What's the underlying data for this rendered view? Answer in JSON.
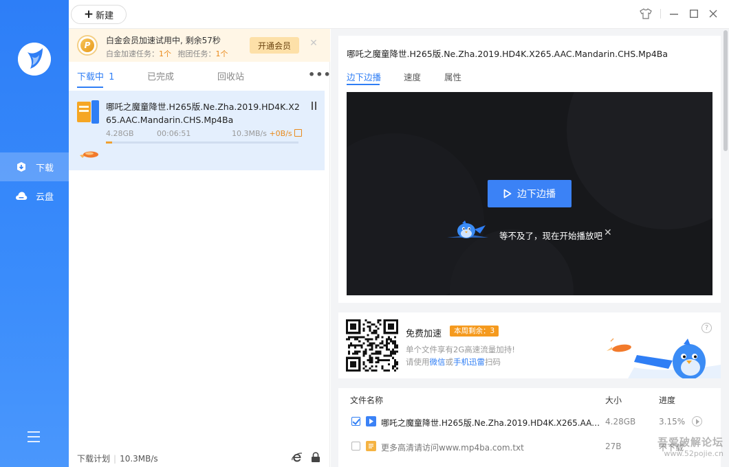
{
  "sidebar": {
    "items": [
      {
        "label": "下载",
        "icon": "download-icon",
        "active": true
      },
      {
        "label": "云盘",
        "icon": "cloud-icon",
        "active": false
      }
    ],
    "menu_icon": "menu-icon",
    "color": "#2f7ef5"
  },
  "toolbar": {
    "new_label": "新建",
    "icons": [
      "skin-icon",
      "settings-icon",
      "minimize-icon",
      "maximize-icon",
      "close-icon"
    ]
  },
  "banner": {
    "title": "白金会员加速试用中, 剩余57秒",
    "accel_label": "白金加速任务：",
    "accel_count": "1个",
    "rescue_label": "抱团任务：",
    "rescue_count": "1个",
    "button": "开通会员"
  },
  "tabs": [
    {
      "label": "下载中",
      "count": "1",
      "active": true
    },
    {
      "label": "已完成",
      "active": false
    },
    {
      "label": "回收站",
      "active": false
    }
  ],
  "task": {
    "name": "哪吒之魔童降世.H265版.Ne.Zha.2019.HD4K.X265.AAC.Mandarin.CHS.Mp4Ba",
    "size": "4.28GB",
    "time": "00:06:51",
    "speed": "10.3MB/s",
    "accel": "+0B/s",
    "progress": 0.0315
  },
  "footer": {
    "plan_label": "下载计划",
    "speed": "10.3MB/s"
  },
  "detail": {
    "title": "哪吒之魔童降世.H265版.Ne.Zha.2019.HD4K.X265.AAC.Mandarin.CHS.Mp4Ba",
    "tabs": [
      "边下边播",
      "速度",
      "属性"
    ],
    "play_button": "边下边播",
    "tip": "等不及了，现在开始播放吧"
  },
  "promo": {
    "title": "免费加速",
    "badge": "本周剩余：3",
    "line1": "单个文件享有2G高速流量加持!",
    "line2_prefix": "请使用",
    "line2_link1": "微信",
    "line2_mid": "或",
    "line2_link2": "手机迅雷",
    "line2_suffix": "扫码"
  },
  "files": {
    "headers": {
      "name": "文件名称",
      "size": "大小",
      "progress": "进度"
    },
    "rows": [
      {
        "checked": true,
        "icon": "video-file-icon",
        "name": "哪吒之魔童降世.H265版.Ne.Zha.2019.HD4K.X265.AAC.Mandarin.CHS.Mp4Ba",
        "size": "4.28GB",
        "progress": "3.15%"
      },
      {
        "checked": false,
        "icon": "text-file-icon",
        "name": "更多高清请访问www.mp4ba.com.txt",
        "size": "27B",
        "progress": "不下载"
      }
    ]
  },
  "watermark": {
    "line1": "吾爱破解论坛",
    "line2": "www.52pojie.cn"
  },
  "colors": {
    "accent": "#2f7ef5",
    "vip": "#e9891a",
    "player_bg": "#17181b"
  }
}
